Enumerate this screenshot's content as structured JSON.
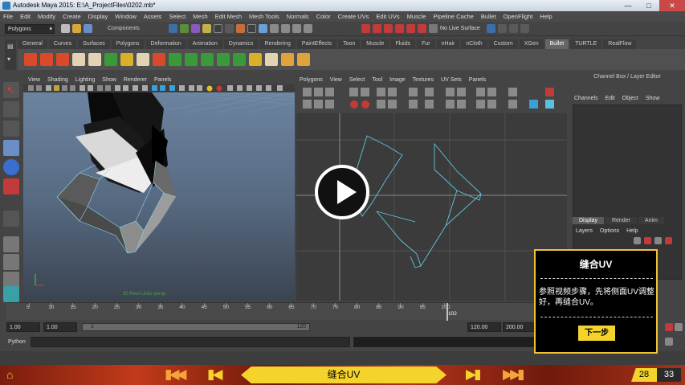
{
  "window": {
    "title": "Autodesk Maya 2015: E:\\A_ProjectFiles\\0202.mb*",
    "controls": [
      "—",
      "□",
      "✕"
    ]
  },
  "menubar": [
    "File",
    "Edit",
    "Modify",
    "Create",
    "Display",
    "Window",
    "Assets",
    "Select",
    "Mesh",
    "Edit Mesh",
    "Mesh Tools",
    "Normals",
    "Color",
    "Create UVs",
    "Edit UVs",
    "Muscle",
    "Pipeline Cache",
    "Bullet",
    "OpenFlight",
    "Help"
  ],
  "statusline": {
    "mode": "Polygons",
    "components_label": "Components",
    "live_surface": "No Live Surface"
  },
  "shelf_tabs": [
    {
      "label": "General",
      "active": false
    },
    {
      "label": "Curves",
      "active": false
    },
    {
      "label": "Surfaces",
      "active": false
    },
    {
      "label": "Polygons",
      "active": false
    },
    {
      "label": "Deformation",
      "active": false
    },
    {
      "label": "Animation",
      "active": false
    },
    {
      "label": "Dynamics",
      "active": false
    },
    {
      "label": "Rendering",
      "active": false
    },
    {
      "label": "PaintEffects",
      "active": false
    },
    {
      "label": "Toon",
      "active": false
    },
    {
      "label": "Muscle",
      "active": false
    },
    {
      "label": "Fluids",
      "active": false
    },
    {
      "label": "Fur",
      "active": false
    },
    {
      "label": "nHair",
      "active": false
    },
    {
      "label": "nCloth",
      "active": false
    },
    {
      "label": "Custom",
      "active": false
    },
    {
      "label": "XGen",
      "active": false
    },
    {
      "label": "Bullet",
      "active": true
    },
    {
      "label": "TURTLE",
      "active": false
    },
    {
      "label": "RealFlow",
      "active": false
    }
  ],
  "viewport": {
    "menu": [
      "View",
      "Shading",
      "Lighting",
      "Show",
      "Renderer",
      "Panels"
    ],
    "hud_text": "30 Pixel Units    persp",
    "colors": {
      "sky_top": "#6f87a4",
      "sky_bottom": "#3b4451",
      "wire": "#7fd4e6"
    }
  },
  "uv_editor": {
    "menu": [
      "Polygons",
      "View",
      "Select",
      "Tool",
      "Image",
      "Textures",
      "UV Sets",
      "Panels"
    ],
    "uv_color": "#5fc6dc"
  },
  "channel_box": {
    "title": "Channel Box / Layer Editor",
    "menu": [
      "Channels",
      "Edit",
      "Object",
      "Show"
    ],
    "tabs": [
      {
        "label": "Display",
        "active": true
      },
      {
        "label": "Render",
        "active": false
      },
      {
        "label": "Anim",
        "active": false
      }
    ],
    "layer_menu": [
      "Layers",
      "Options",
      "Help"
    ]
  },
  "timeline": {
    "ticks": [
      "5",
      "10",
      "15",
      "20",
      "25",
      "30",
      "35",
      "40",
      "45",
      "50",
      "55",
      "60",
      "65",
      "70",
      "75",
      "80",
      "85",
      "90",
      "95",
      "100"
    ],
    "current_frame": "102"
  },
  "range": {
    "start": "1.00",
    "start_inner": "1.00",
    "range_start": "1",
    "range_end": "120",
    "end_inner": "120.00",
    "end": "200.00"
  },
  "command_line": {
    "label": "Python"
  },
  "overlay": {
    "title": "缝合UV",
    "body": "参照视频步骤，先将侧面UV调整好，再缝合UV。",
    "next_button": "下一步",
    "accent": "#f1c232"
  },
  "navbar": {
    "title": "缝合UV",
    "current_page": "28",
    "total_pages": "33",
    "banner_color": "#f4d32c"
  }
}
